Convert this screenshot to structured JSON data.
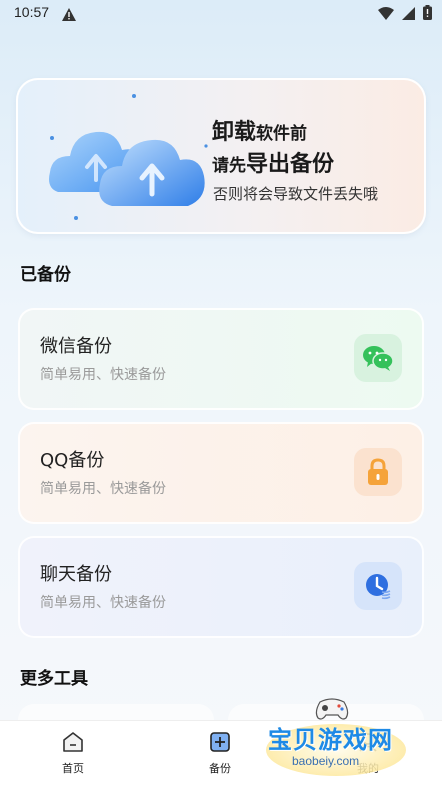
{
  "status_bar": {
    "time": "10:57",
    "icons": [
      "alert-icon",
      "wifi-icon",
      "signal-icon",
      "battery-icon"
    ]
  },
  "banner": {
    "line1_big": "卸载",
    "line1_small": "软件前",
    "line2_small": "请先",
    "line2_big": "导出备份",
    "subtitle": "否则将会导致文件丢失哦"
  },
  "sections": {
    "backed_up": "已备份",
    "more_tools": "更多工具"
  },
  "cards": [
    {
      "title": "微信备份",
      "desc": "简单易用、快速备份",
      "icon": "wechat-icon",
      "accent": "#35c15b"
    },
    {
      "title": "QQ备份",
      "desc": "简单易用、快速备份",
      "icon": "lock-icon",
      "accent": "#f5a33a"
    },
    {
      "title": "聊天备份",
      "desc": "简单易用、快速备份",
      "icon": "chat-clock-icon",
      "accent": "#2f6fe0"
    }
  ],
  "bottom_nav": [
    {
      "label": "首页",
      "icon": "home-icon"
    },
    {
      "label": "备份",
      "icon": "backup-plus-icon"
    },
    {
      "label": "我的",
      "icon": "profile-icon"
    }
  ],
  "watermark": {
    "text": "宝贝游戏网",
    "url": "baobeiy.com"
  },
  "colors": {
    "wechat_green": "#35c15b",
    "lock_orange": "#f5a33a",
    "chat_blue": "#2f6fe0",
    "watermark_blue": "#1e8ae6"
  }
}
